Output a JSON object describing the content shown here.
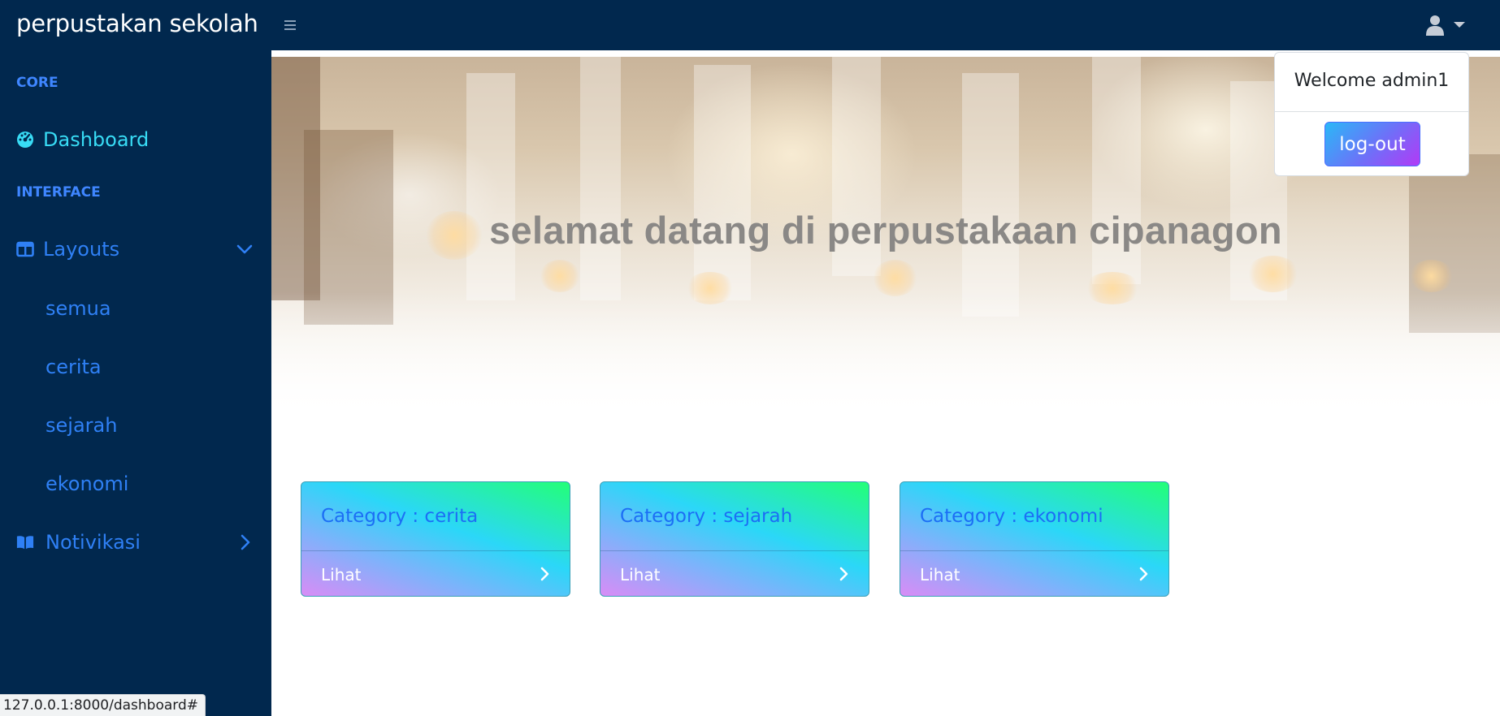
{
  "brand": "perpustakan sekolah",
  "sidebar": {
    "headings": {
      "core": "CORE",
      "interface": "INTERFACE"
    },
    "dashboard": {
      "label": "Dashboard",
      "icon": "tachometer-icon"
    },
    "layouts": {
      "label": "Layouts",
      "icon": "columns-icon",
      "expanded": true
    },
    "sub_items": [
      {
        "label": "semua"
      },
      {
        "label": "cerita"
      },
      {
        "label": "sejarah"
      },
      {
        "label": "ekonomi"
      }
    ],
    "notifications": {
      "label": "Notivikasi",
      "icon": "book-open-icon"
    }
  },
  "hero": {
    "title": "selamat datang di perpustakaan cipanagon"
  },
  "cards": [
    {
      "title": "Category : cerita",
      "link": "Lihat"
    },
    {
      "title": "Category : sejarah",
      "link": "Lihat"
    },
    {
      "title": "Category : ekonomi",
      "link": "Lihat"
    }
  ],
  "user_menu": {
    "welcome": "Welcome admin1",
    "logout_label": "log-out"
  },
  "status_url": "127.0.0.1:8000/dashboard#",
  "colors": {
    "navbar": "#01284e",
    "sidebar_link": "#2f80f5",
    "sidebar_active": "#38dcf5",
    "heading": "#3f86ff"
  }
}
